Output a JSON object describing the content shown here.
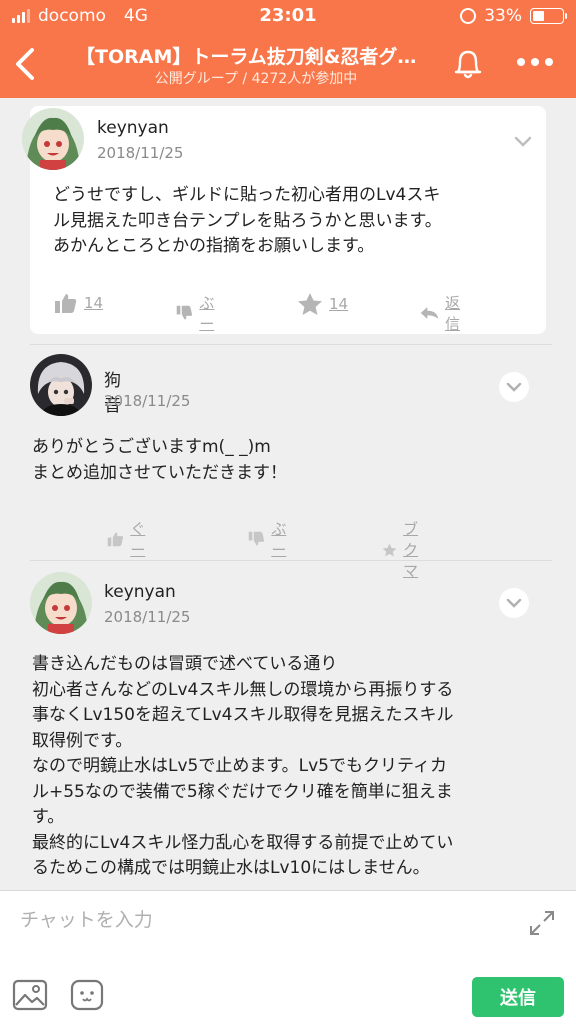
{
  "status_bar": {
    "carrier": "docomo",
    "network": "4G",
    "time": "23:01",
    "battery": "33%",
    "battery_level": 0.33
  },
  "header": {
    "title": "【TORAM】トーラム抜刀剣&忍者グ…",
    "subtitle": "公開グループ / 4272人が参加中",
    "icons": [
      "back-chevron-icon",
      "bell-icon",
      "more-dots-icon"
    ]
  },
  "posts": [
    {
      "user": "keynyan",
      "date": "2018/11/25",
      "text": [
        "どうせですし、ギルドに貼った初心者用のLv4スキ",
        "ル見据えた叩き台テンプレを貼ろうかと思います。",
        "あかんところとかの指摘をお願いします。"
      ],
      "actions": {
        "like": "14",
        "dislike": "ぶー",
        "bookmark": "14",
        "reply": "返信"
      }
    },
    {
      "user": "狗音",
      "date": "2018/11/25",
      "text": [
        "ありがとうございますm(_ _)m",
        "まとめ追加させていただきます！"
      ],
      "actions": {
        "like": "ぐー",
        "dislike": "ぶー",
        "bookmark": "ブクマ"
      }
    },
    {
      "user": "keynyan",
      "date": "2018/11/25",
      "text": [
        "書き込んだものは冒頭で述べている通り",
        "初心者さんなどのLv4スキル無しの環境から再振りする",
        "事なくLv150を超えてLv4スキル取得を見据えたスキル",
        "取得例です。",
        "なので明鏡止水はLv5で止めます。Lv5でもクリティカ",
        "ル+55なので装備で5稼ぐだけでクリ確を簡単に狙えま",
        "す。",
        "最終的にLv4スキル怪力乱心を取得する前提で止めてい",
        "るためこの構成では明鏡止水はLv10にはしません。"
      ]
    }
  ],
  "input": {
    "placeholder": "チャットを入力",
    "send_label": "送信"
  },
  "colors": {
    "header_bg": "#f9764a",
    "send_bg": "#2fc36f",
    "page_bg": "#efefef"
  }
}
